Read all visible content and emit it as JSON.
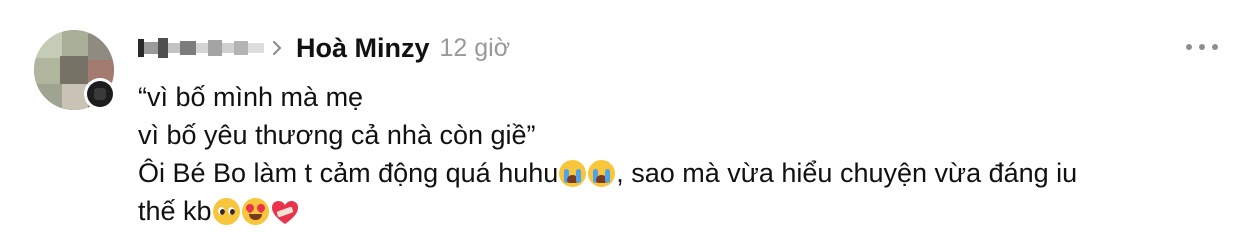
{
  "comment": {
    "author": "Hoà Minzy",
    "time": "12 giờ",
    "lines": [
      "“vì bố mình mà mẹ",
      "vì bố yêu thương cả nhà còn giề”",
      "Ôi Bé Bo làm t cảm động quá huhu",
      ", sao mà vừa hiểu chuyện vừa đáng iu",
      "thế kb"
    ],
    "emojis": {
      "line3": [
        "loudly-crying-face",
        "loudly-crying-face"
      ],
      "line4": [
        "pleading-face",
        "smiling-face-with-heart-eyes",
        "mending-heart"
      ]
    }
  },
  "icons": {
    "chevron": "chevron-right-icon",
    "more": "more-options-icon"
  },
  "colors": {
    "text": "#111111",
    "time": "#9a9a9a",
    "icon": "#8e8e8e"
  }
}
